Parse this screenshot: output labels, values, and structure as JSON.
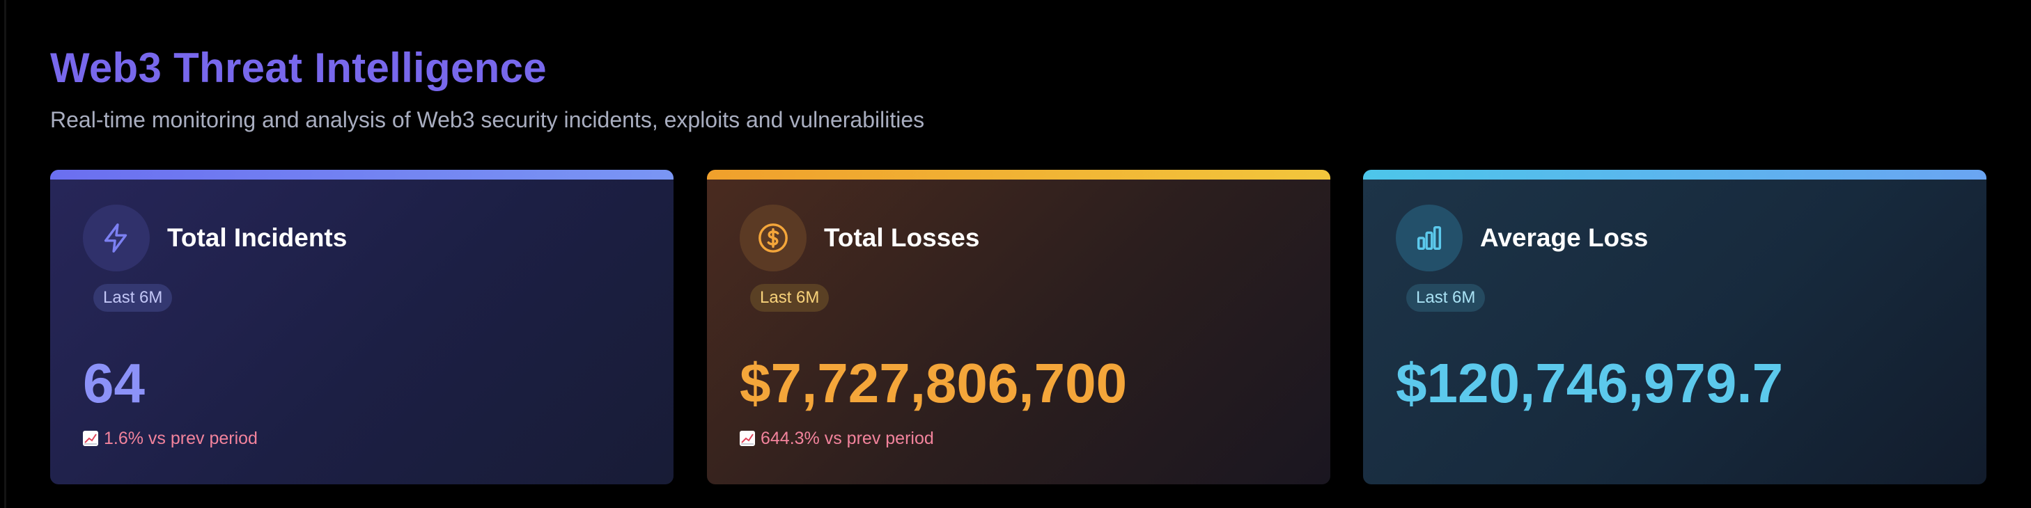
{
  "header": {
    "title": "Web3 Threat Intelligence",
    "subtitle": "Real-time monitoring and analysis of Web3 security incidents, exploits and vulnerabilities"
  },
  "cards": [
    {
      "title": "Total Incidents",
      "badge": "Last 6M",
      "value": "64",
      "change": "1.6% vs prev period",
      "icon": "lightning-icon",
      "accent": "#6b6ff0"
    },
    {
      "title": "Total Losses",
      "badge": "Last 6M",
      "value": "$7,727,806,700",
      "change": "644.3% vs prev period",
      "icon": "dollar-coin-icon",
      "accent": "#f0a02c"
    },
    {
      "title": "Average Loss",
      "badge": "Last 6M",
      "value": "$120,746,979.7",
      "icon": "bar-chart-icon",
      "accent": "#4dc6ea"
    }
  ],
  "colors": {
    "background": "#000000",
    "title": "#7868ec",
    "subtitle": "#a9aec0",
    "change_text": "#f2839c"
  }
}
